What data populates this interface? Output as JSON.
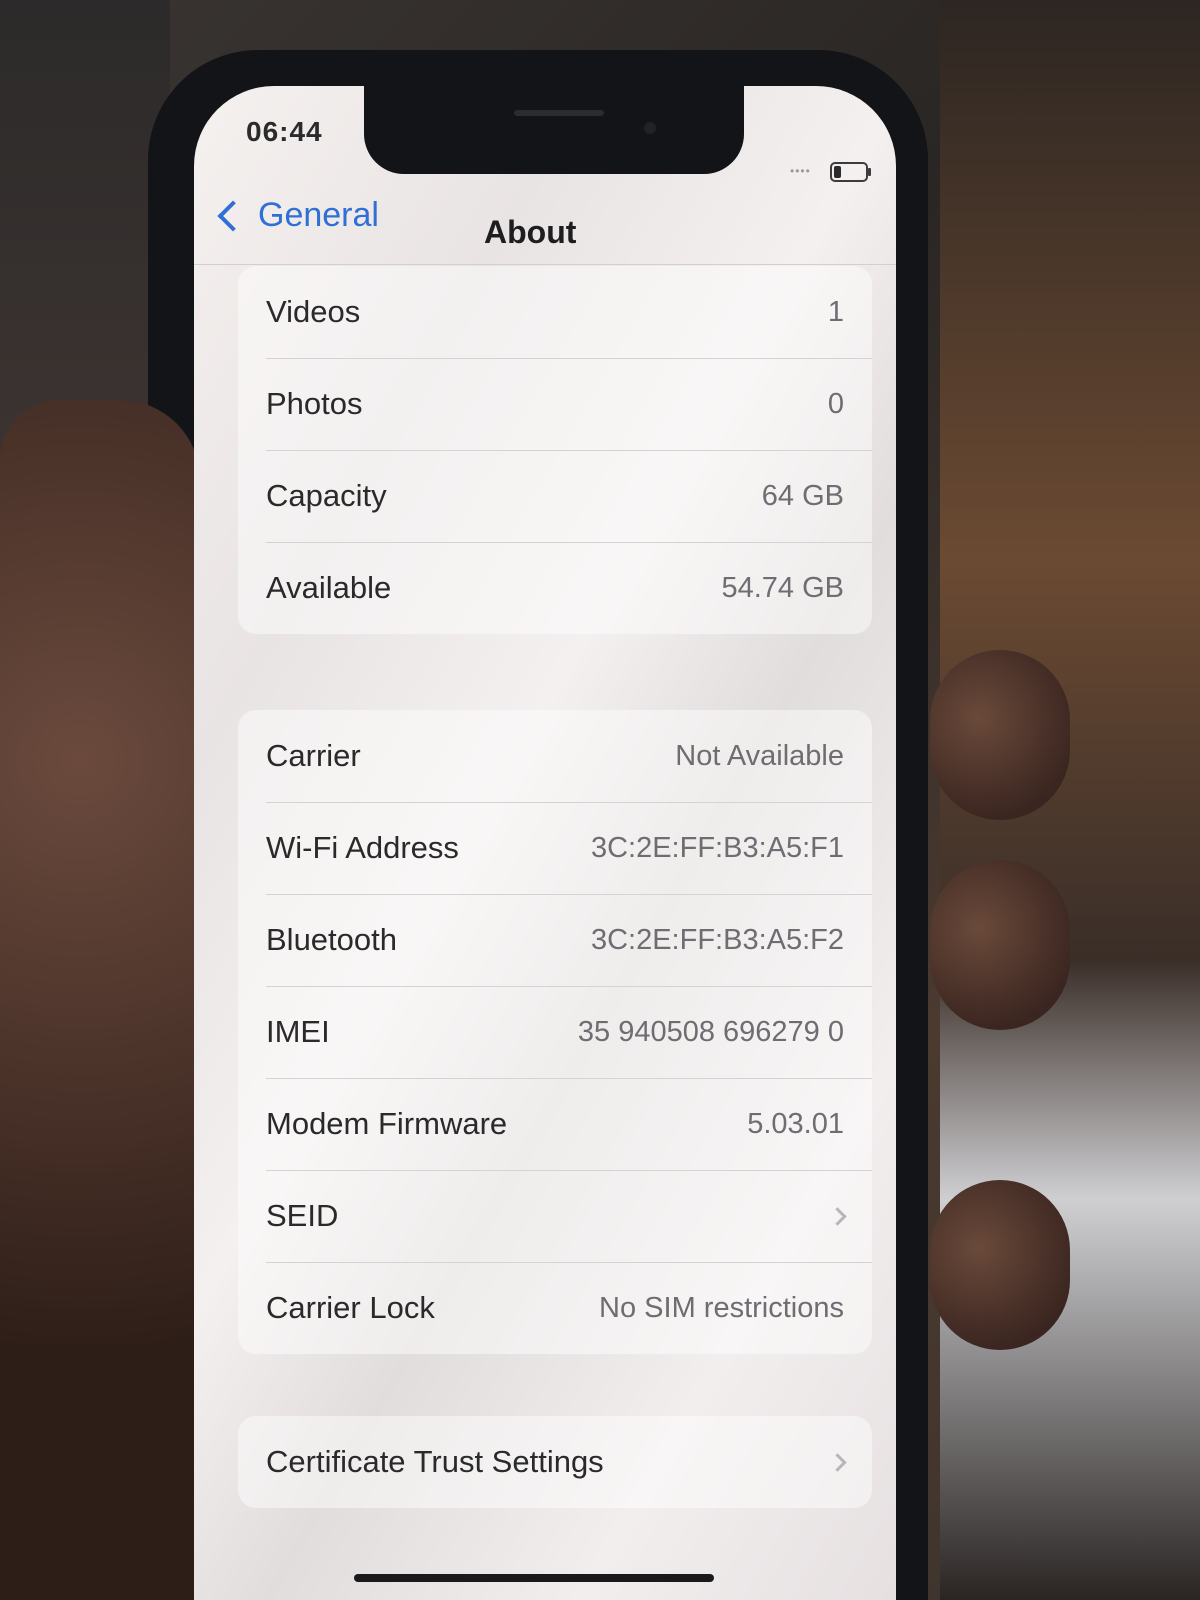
{
  "status_bar": {
    "time": "06:44",
    "signal": "••••"
  },
  "nav": {
    "back_label": "General",
    "title": "About"
  },
  "groups": [
    [
      {
        "label": "Videos",
        "value": "1"
      },
      {
        "label": "Photos",
        "value": "0"
      },
      {
        "label": "Capacity",
        "value": "64 GB"
      },
      {
        "label": "Available",
        "value": "54.74 GB"
      }
    ],
    [
      {
        "label": "Carrier",
        "value": "Not Available"
      },
      {
        "label": "Wi-Fi Address",
        "value": "3C:2E:FF:B3:A5:F1"
      },
      {
        "label": "Bluetooth",
        "value": "3C:2E:FF:B3:A5:F2"
      },
      {
        "label": "IMEI",
        "value": "35 940508 696279 0"
      },
      {
        "label": "Modem Firmware",
        "value": "5.03.01"
      },
      {
        "label": "SEID",
        "value": ""
      },
      {
        "label": "Carrier Lock",
        "value": "No SIM restrictions"
      }
    ],
    [
      {
        "label": "Certificate Trust Settings",
        "value": ""
      }
    ]
  ],
  "colors": {
    "accent": "#2f6fd6",
    "text": "#2a2a2c",
    "secondary": "#6e6d72"
  }
}
